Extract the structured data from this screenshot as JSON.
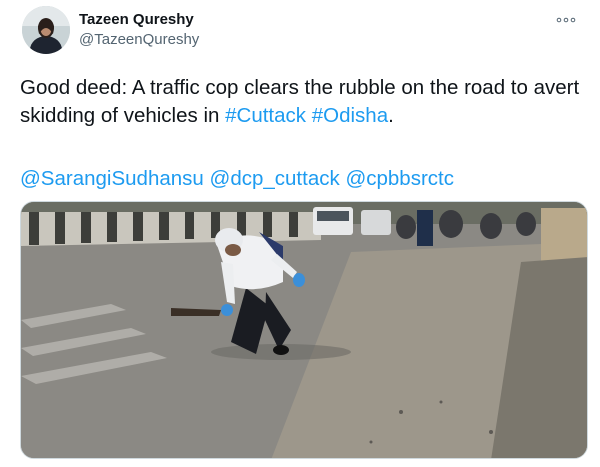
{
  "author": {
    "display_name": "Tazeen Qureshy",
    "handle": "@TazeenQureshy",
    "avatar_icon": "profile-photo"
  },
  "more_icon": "more-options-icon",
  "tweet": {
    "text_plain": "Good deed: A traffic cop clears the rubble on the road to avert skidding of vehicles in ",
    "hashtag_1": "#Cuttack",
    "space": " ",
    "hashtag_2": "#Odisha",
    "period": ".",
    "mention_1": "@SarangiSudhansu",
    "mention_2": "@dcp_cuttack",
    "mention_3": "@cpbbsrctc"
  },
  "colors": {
    "link": "#1d9bf0",
    "text": "#0f1419",
    "muted": "#536471"
  }
}
